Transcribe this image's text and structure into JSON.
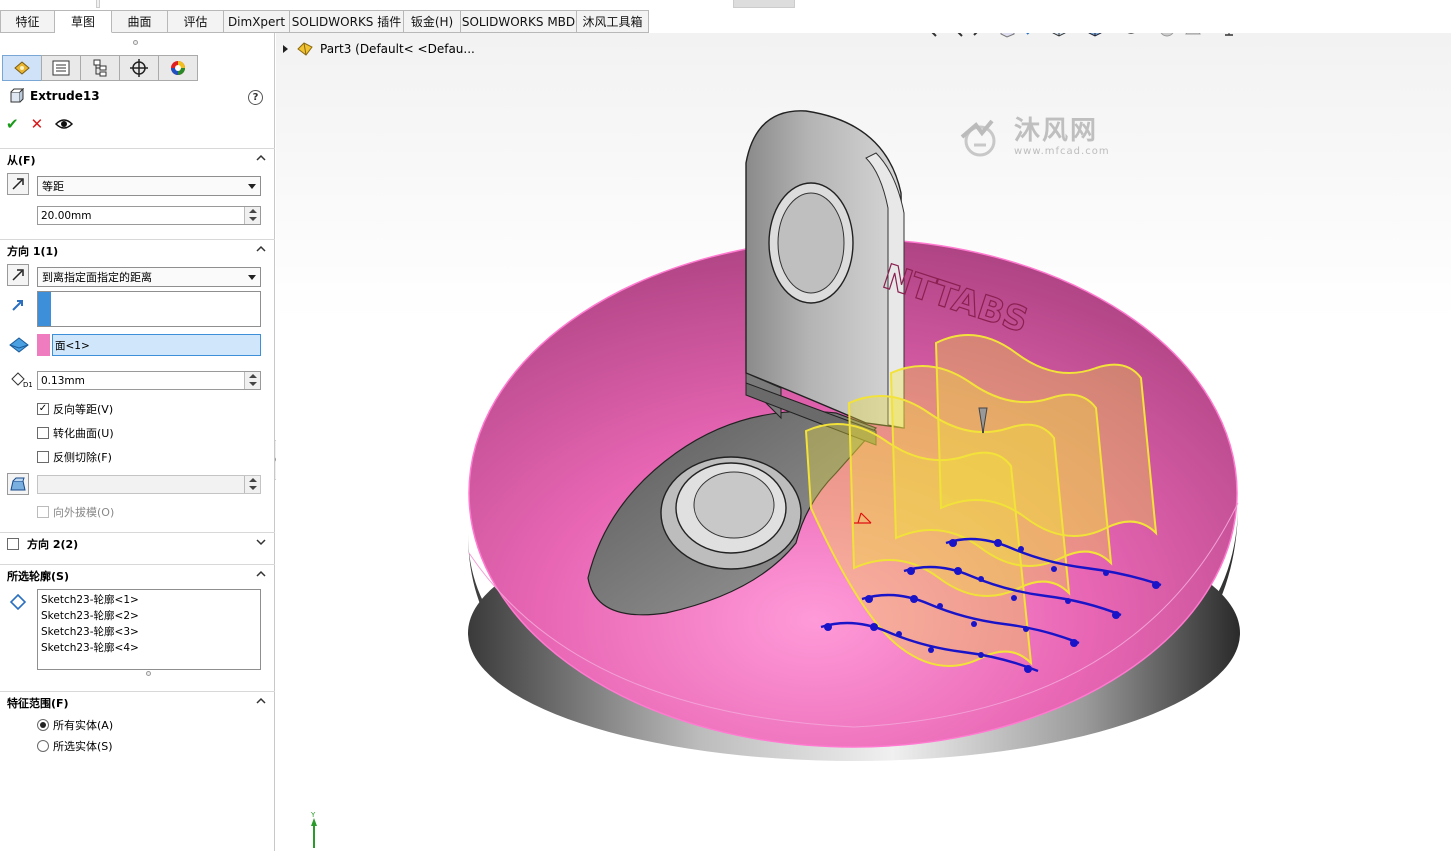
{
  "tabs": [
    {
      "label": "特征",
      "active": false,
      "w": 55
    },
    {
      "label": "草图",
      "active": true,
      "w": 57
    },
    {
      "label": "曲面",
      "active": false,
      "w": 56
    },
    {
      "label": "评估",
      "active": false,
      "w": 56
    },
    {
      "label": "DimXpert",
      "active": false,
      "w": 66
    },
    {
      "label": "SOLIDWORKS 插件",
      "active": false,
      "w": 114
    },
    {
      "label": "钣金(H)",
      "active": false,
      "w": 57
    },
    {
      "label": "SOLIDWORKS MBD",
      "active": false,
      "w": 116
    },
    {
      "label": "沐风工具箱",
      "active": false,
      "w": 72
    }
  ],
  "feature": {
    "title": "Extrude13",
    "help": "?"
  },
  "from": {
    "header": "从(F)",
    "type": "等距",
    "offset": "20.00mm"
  },
  "direction1": {
    "header": "方向 1(1)",
    "end_condition": "到离指定面指定的距离",
    "face": "面<1>",
    "distance": "0.13mm",
    "reverse_offset": "反向等距(V)",
    "translate_surface": "转化曲面(U)",
    "flip_cut": "反侧切除(F)",
    "draft_outward": "向外拔模(O)",
    "reverse_offset_checked": true
  },
  "direction2": {
    "header": "方向 2(2)"
  },
  "contours": {
    "header": "所选轮廓(S)",
    "items": [
      "Sketch23-轮廓<1>",
      "Sketch23-轮廓<2>",
      "Sketch23-轮廓<3>",
      "Sketch23-轮廓<4>"
    ]
  },
  "scope": {
    "header": "特征范围(F)",
    "all_bodies": "所有实体(A)",
    "selected_bodies": "所选实体(S)"
  },
  "viewport": {
    "tree_label": "Part3  (Default< <Defau...",
    "embossed_text": "NTTABS",
    "watermark_cn": "沐风网",
    "watermark_url": "www.mfcad.com",
    "axis_y": "Y"
  },
  "colors": {
    "accent_blue": "#3c8fd8",
    "selection_pink": "#f07cc0",
    "body_pink": "#e866b4",
    "sketch_blue": "#1a14c8",
    "preview_yellow": "#f2e23a"
  }
}
